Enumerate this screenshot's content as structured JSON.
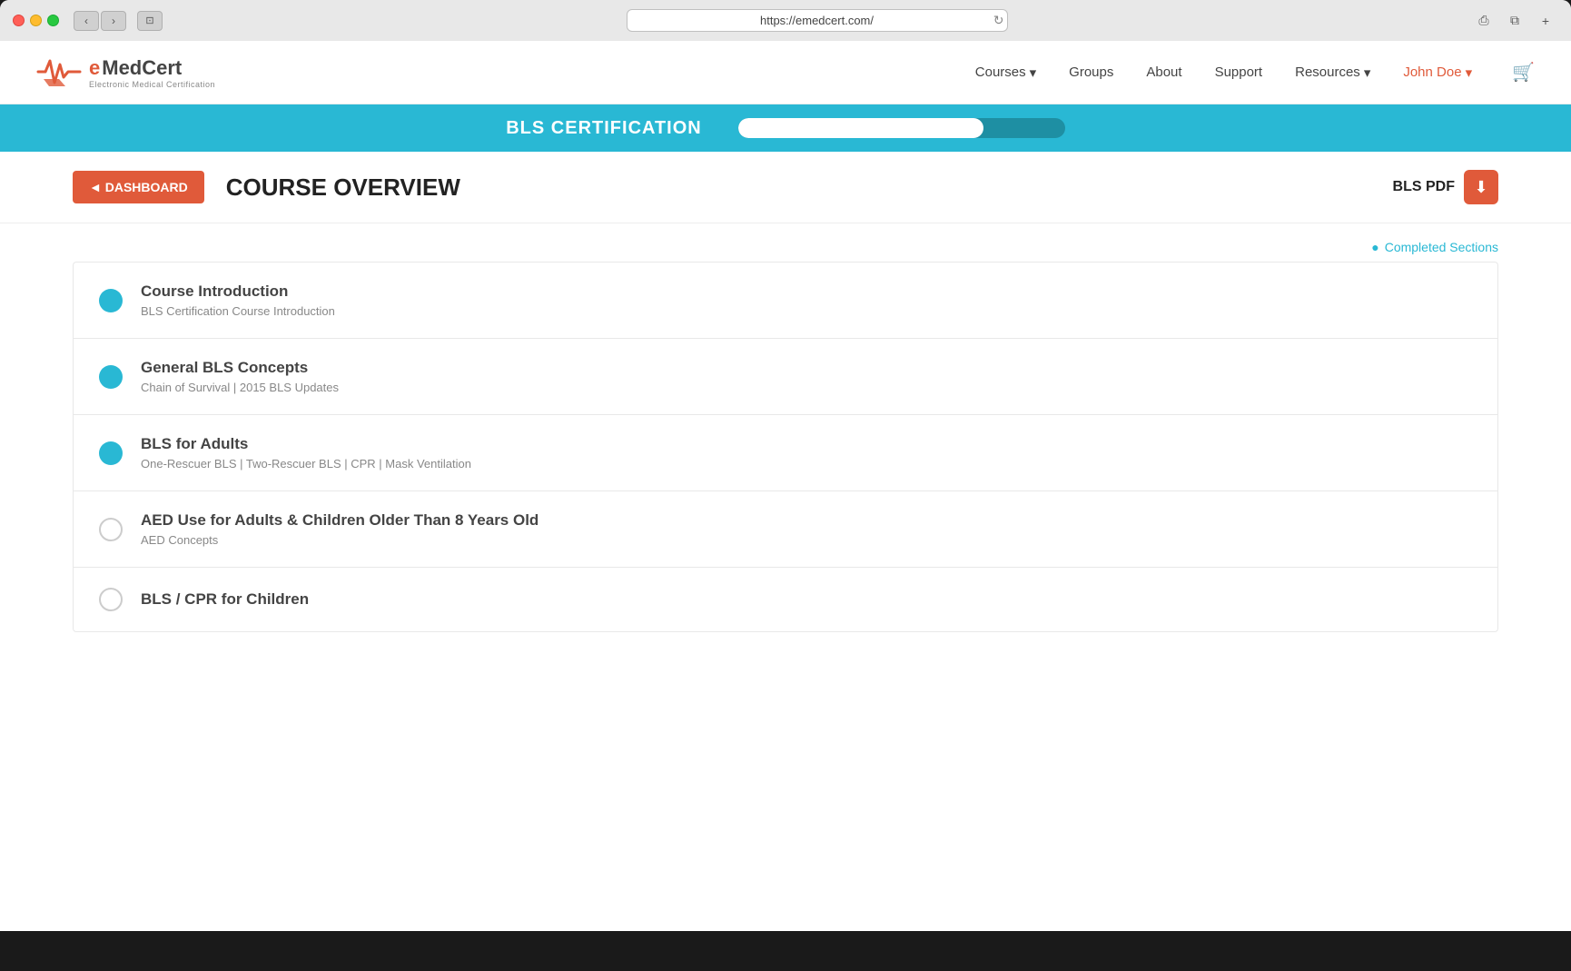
{
  "browser": {
    "url": "https://emedcert.com/",
    "traffic_lights": [
      "red",
      "yellow",
      "green"
    ]
  },
  "navbar": {
    "logo_e": "e",
    "logo_medcert": "MedCert",
    "logo_sub": "Electronic Medical Certification",
    "courses_label": "Courses",
    "groups_label": "Groups",
    "about_label": "About",
    "support_label": "Support",
    "resources_label": "Resources",
    "user_label": "John Doe",
    "chevron": "▾"
  },
  "progress_banner": {
    "title": "BLS CERTIFICATION",
    "progress_percent": 75
  },
  "course_header": {
    "dashboard_label": "◄ DASHBOARD",
    "course_title": "COURSE OVERVIEW",
    "pdf_label": "BLS PDF",
    "download_icon": "⬇"
  },
  "legend": {
    "label": "● Completed Sections"
  },
  "course_items": [
    {
      "id": 1,
      "name": "Course Introduction",
      "description": "BLS Certification Course Introduction",
      "completed": true
    },
    {
      "id": 2,
      "name": "General BLS Concepts",
      "description": "Chain of Survival | 2015 BLS Updates",
      "completed": true
    },
    {
      "id": 3,
      "name": "BLS for Adults",
      "description": "One-Rescuer BLS | Two-Rescuer BLS | CPR | Mask Ventilation",
      "completed": true
    },
    {
      "id": 4,
      "name": "AED Use for Adults & Children Older Than 8 Years Old",
      "description": "AED Concepts",
      "completed": false
    },
    {
      "id": 5,
      "name": "BLS / CPR for Children",
      "description": "",
      "completed": false
    }
  ]
}
